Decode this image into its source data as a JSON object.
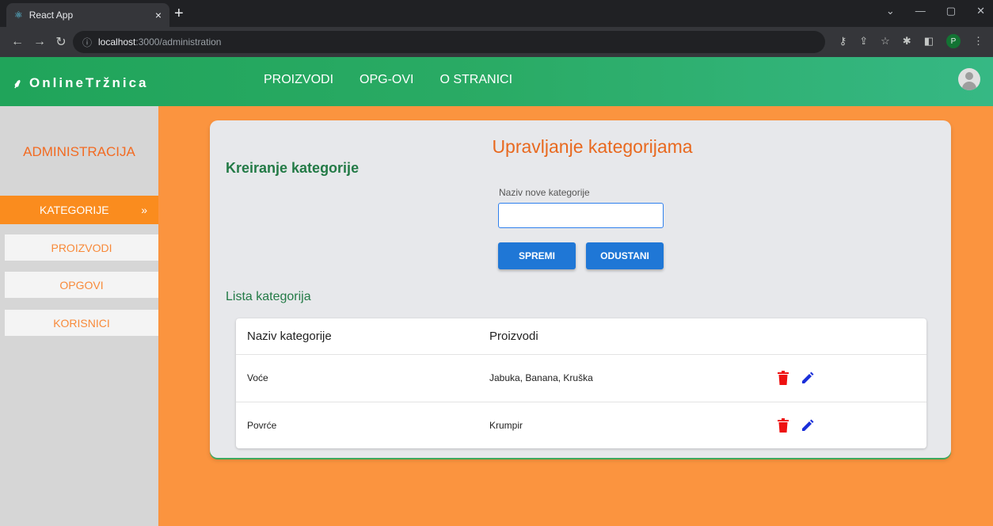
{
  "browser": {
    "tab_title": "React App",
    "tab_close": "×",
    "new_tab": "+",
    "url_host": "localhost",
    "url_path": ":3000/administration",
    "profile_initial": "P"
  },
  "header": {
    "logo": "OnlineTržnica",
    "nav": [
      "PROIZVODI",
      "OPG-OVI",
      "O STRANICI"
    ]
  },
  "sidebar": {
    "title": "ADMINISTRACIJA",
    "items": [
      {
        "label": "KATEGORIJE",
        "active": true
      },
      {
        "label": "PROIZVODI",
        "active": false
      },
      {
        "label": "OPGOVI",
        "active": false
      },
      {
        "label": "KORISNICI",
        "active": false
      }
    ]
  },
  "page": {
    "title": "Upravljanje kategorijama",
    "create_title": "Kreiranje kategorije",
    "field_label": "Naziv nove kategorije",
    "field_value": "",
    "save_label": "SPREMI",
    "cancel_label": "ODUSTANI",
    "list_title": "Lista kategorija"
  },
  "table": {
    "headers": [
      "Naziv kategorije",
      "Proizvodi"
    ],
    "rows": [
      {
        "name": "Voće",
        "products": "Jabuka, Banana, Kruška"
      },
      {
        "name": "Povrće",
        "products": "Krumpir"
      }
    ]
  },
  "colors": {
    "header_green": "#2aab65",
    "accent_orange": "#fb943f",
    "primary_blue": "#1f77d6",
    "delete_red": "#e11",
    "edit_blue": "#1a2fd9"
  }
}
